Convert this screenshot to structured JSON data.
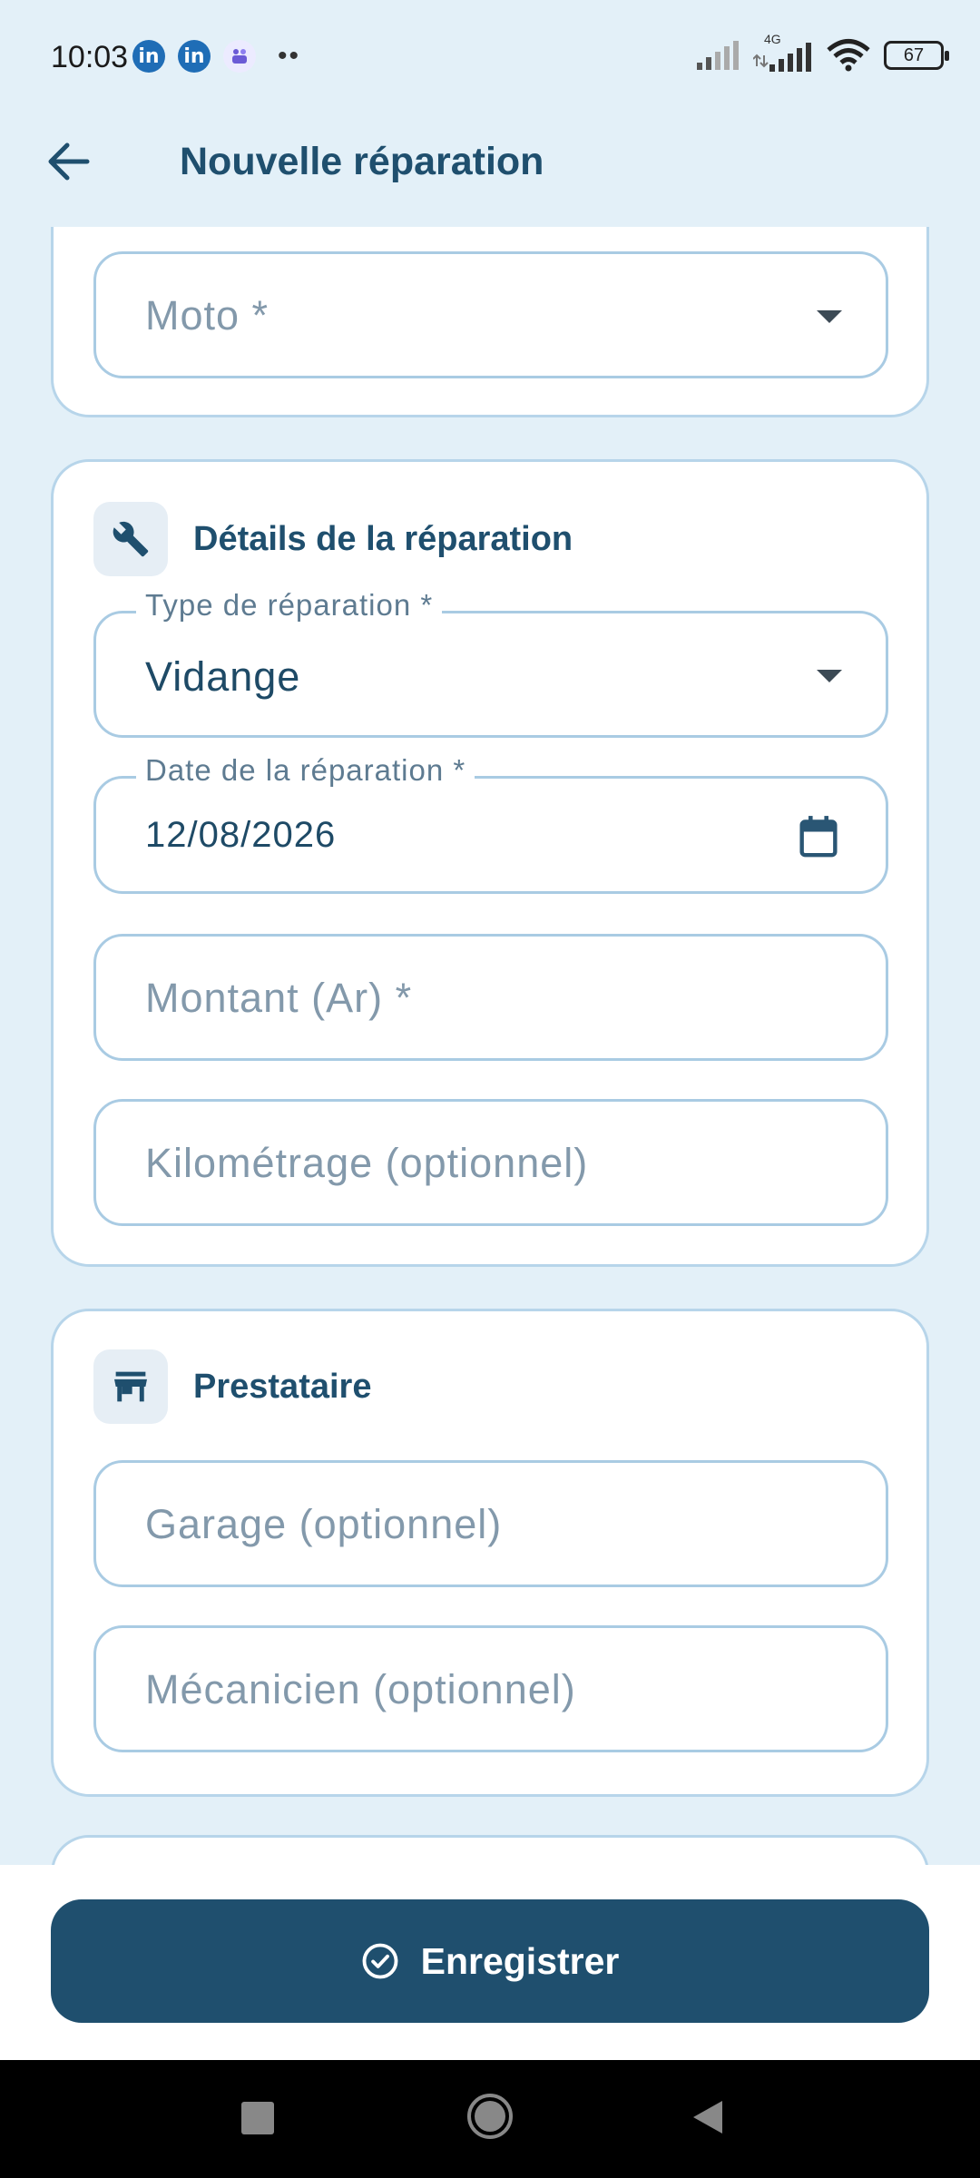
{
  "status_bar": {
    "time": "10:03",
    "battery": "67",
    "network": "4G"
  },
  "app_bar": {
    "title": "Nouvelle réparation"
  },
  "vehicle_card": {
    "moto_placeholder": "Moto *"
  },
  "details_card": {
    "title": "Détails de la réparation",
    "repair_type_label": "Type de réparation *",
    "repair_type_value": "Vidange",
    "date_label": "Date de la réparation *",
    "date_value": "12/08/2026",
    "amount_placeholder": "Montant (Ar) *",
    "mileage_placeholder": "Kilométrage (optionnel)"
  },
  "provider_card": {
    "title": "Prestataire",
    "garage_placeholder": "Garage (optionnel)",
    "mechanic_placeholder": "Mécanicien (optionnel)"
  },
  "footer": {
    "save_label": "Enregistrer"
  },
  "colors": {
    "primary": "#1f4f6e",
    "background": "#e3f0f8",
    "border": "#a9cbe3"
  },
  "icons": [
    "back-arrow-icon",
    "wrench-icon",
    "store-icon",
    "calendar-icon",
    "check-circle-icon"
  ]
}
